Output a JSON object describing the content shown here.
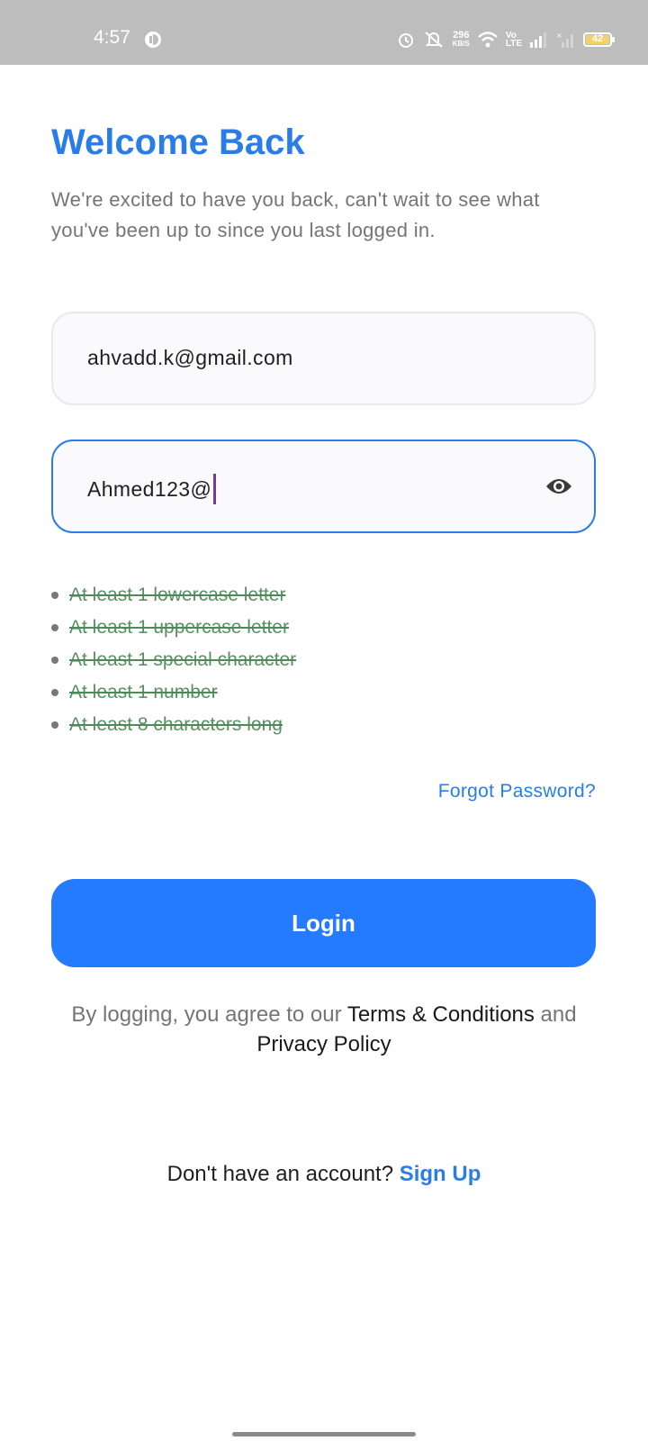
{
  "status_bar": {
    "time": "4:57",
    "net_speed_value": "296",
    "net_speed_unit": "KB/S",
    "volte_top": "Vo",
    "volte_bottom": "LTE",
    "battery": "42"
  },
  "header": {
    "title": "Welcome Back",
    "subtitle": "We're excited to have you back, can't wait to see what you've been up to since you last logged in."
  },
  "form": {
    "email_value": "ahvadd.k@gmail.com",
    "password_value": "Ahmed123@",
    "password_rules": [
      "At least 1 lowercase letter",
      "At least 1 uppercase letter",
      "At least 1 special character",
      "At least 1 number",
      "At least 8 characters long"
    ],
    "forgot_label": "Forgot Password?",
    "login_label": "Login"
  },
  "terms": {
    "prefix": "By logging, you agree to our ",
    "terms_link": "Terms & Conditions",
    "middle": " and",
    "privacy_link": "Privacy Policy"
  },
  "signup": {
    "prompt": "Don't have an account? ",
    "link": "Sign Up"
  },
  "colors": {
    "accent": "#247bff",
    "title": "#2a7de8",
    "rule_done": "#4a8b5a"
  },
  "icons": [
    "timer-icon",
    "mute-icon",
    "wifi-icon",
    "signal-icon",
    "battery-icon",
    "eye-icon"
  ]
}
